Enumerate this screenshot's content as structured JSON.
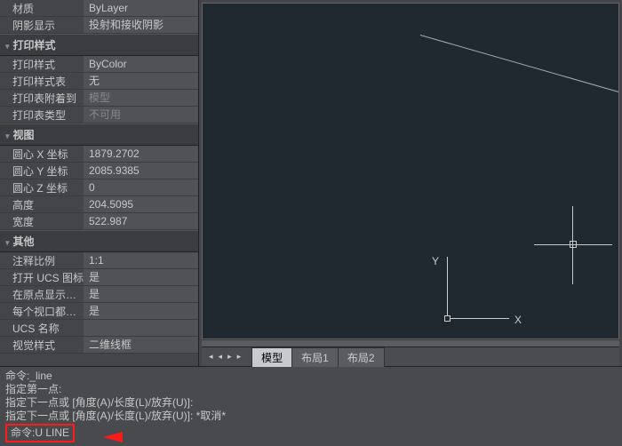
{
  "props": {
    "row0": {
      "label": "材质",
      "value": "ByLayer"
    },
    "row1": {
      "label": "阴影显示",
      "value": "投射和接收阴影"
    },
    "sec_print": "打印样式",
    "print_style": {
      "label": "打印样式",
      "value": "ByColor"
    },
    "print_table": {
      "label": "打印样式表",
      "value": "无"
    },
    "print_attach": {
      "label": "打印表附着到",
      "value": "模型"
    },
    "print_type": {
      "label": "打印表类型",
      "value": "不可用"
    },
    "sec_view": "视图",
    "cx": {
      "label": "圆心 X 坐标",
      "value": "1879.2702"
    },
    "cy": {
      "label": "圆心 Y 坐标",
      "value": "2085.9385"
    },
    "cz": {
      "label": "圆心 Z 坐标",
      "value": "0"
    },
    "height": {
      "label": "高度",
      "value": "204.5095"
    },
    "width": {
      "label": "宽度",
      "value": "522.987"
    },
    "sec_other": "其他",
    "anno": {
      "label": "注释比例",
      "value": "1:1"
    },
    "ucs_icon": {
      "label": "打开 UCS 图标",
      "value": "是"
    },
    "origin": {
      "label": "在原点显示…",
      "value": "是"
    },
    "perview": {
      "label": "每个视口都…",
      "value": "是"
    },
    "ucs_name": {
      "label": "UCS 名称",
      "value": ""
    },
    "vstyle": {
      "label": "视觉样式",
      "value": "二维线框"
    }
  },
  "ucs": {
    "x": "X",
    "y": "Y"
  },
  "tabs": {
    "nav": {
      "first": "◂",
      "prev": "◂",
      "next": "▸",
      "last": "▸"
    },
    "model": "模型",
    "layout1": "布局1",
    "layout2": "布局2"
  },
  "cmd": {
    "l1": "命令:_line",
    "l2": "指定第一点:",
    "l3": "指定下一点或 [角度(A)/长度(L)/放弃(U)]:",
    "l4": "指定下一点或 [角度(A)/长度(L)/放弃(U)]: *取消*",
    "l5": "命令:U LINE"
  }
}
